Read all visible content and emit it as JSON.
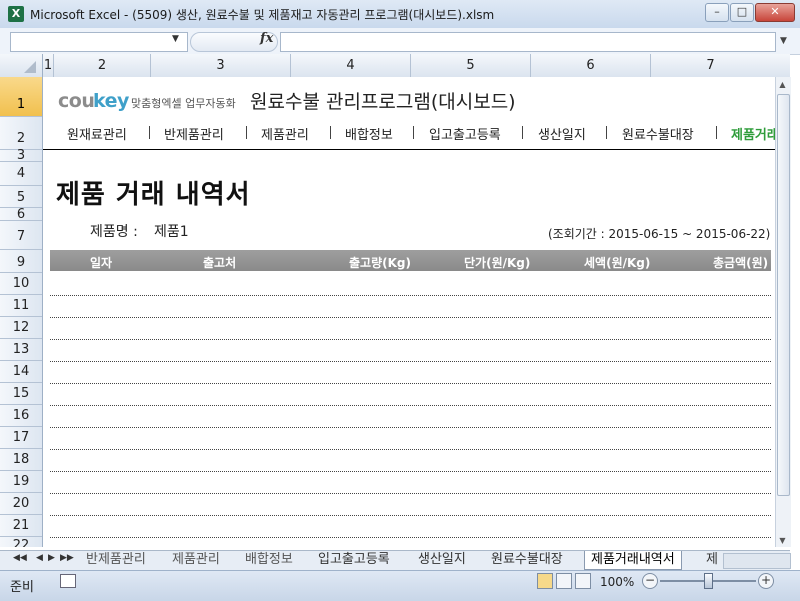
{
  "window": {
    "title": "Microsoft Excel - (5509) 생산, 원료수불 및 제품재고 자동관리 프로그램(대시보드).xlsm",
    "app_icon": "X"
  },
  "formula_bar": {
    "fx": "fx",
    "name_box": "",
    "formula": ""
  },
  "columns": [
    "1",
    "2",
    "3",
    "4",
    "5",
    "6",
    "7"
  ],
  "rows": [
    "1",
    "2",
    "3",
    "4",
    "5",
    "6",
    "7",
    "9",
    "10",
    "11",
    "12",
    "13",
    "14",
    "15",
    "16",
    "17",
    "18",
    "19",
    "20",
    "21",
    "22"
  ],
  "logo": {
    "cou": "cou",
    "key": "key",
    "slogan": "맞춤형엑셀 업무자동화"
  },
  "app_title": "원료수불 관리프로그램(대시보드)",
  "nav": [
    "원재료관리",
    "반제품관리",
    "제품관리",
    "배합정보",
    "입고출고등록",
    "생산일지",
    "원료수불대장",
    "제품거래"
  ],
  "nav_active": "제품거래",
  "page_title": "제품 거래 내역서",
  "product": {
    "label": "제품명 :",
    "value": "제품1"
  },
  "period": "(조회기간 : 2015-06-15 ~ 2015-06-22)",
  "table_headers": [
    "일자",
    "출고처",
    "출고량(Kg)",
    "단가(원/Kg)",
    "세액(원/Kg)",
    "총금액(원)"
  ],
  "sheet_tabs": [
    "반제품관리",
    "제품관리",
    "배합정보",
    "입고출고등록",
    "생산일지",
    "원료수불대장",
    "제품거래내역서",
    "제"
  ],
  "sheet_tab_active": "제품거래내역서",
  "status": {
    "ready": "준비",
    "zoom": "100%"
  },
  "zoom_fraction": 0.5,
  "colors": {
    "accent_green": "#2e9c3a",
    "logo_blue": "#3fa0c9",
    "header_gray": "#959595"
  }
}
